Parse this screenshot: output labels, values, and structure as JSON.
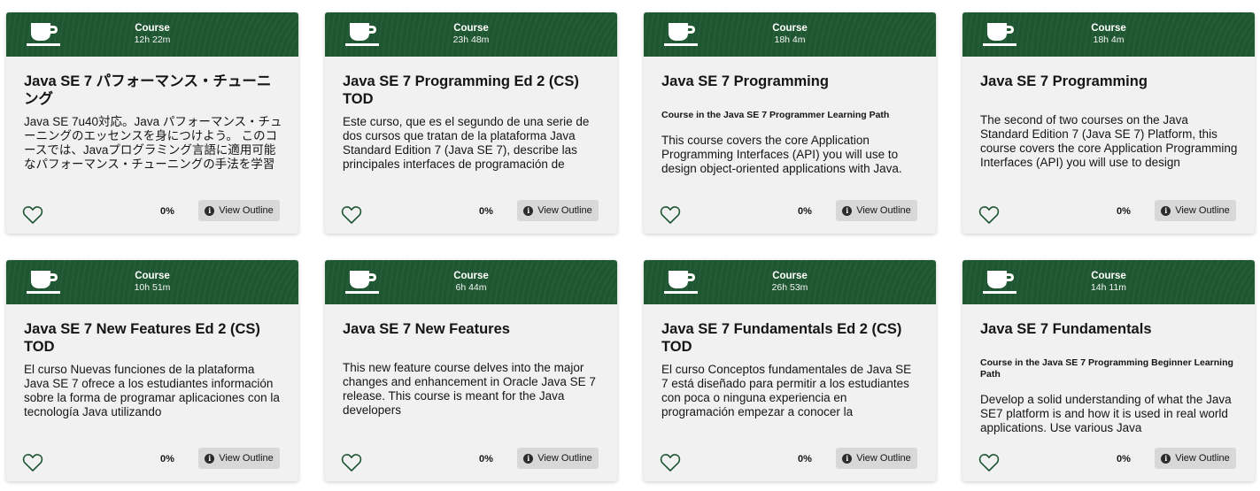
{
  "accent_color": "#1e5631",
  "icons": {
    "card_icon": "coffee-cup-icon",
    "favorite_icon": "heart-outline-icon",
    "outline_icon": "info-icon"
  },
  "cards": [
    {
      "type": "Course",
      "duration": "12h 22m",
      "title": "Java SE 7 パフォーマンス・チューニング",
      "learning_path": "",
      "description": "Java SE 7u40対応。Java パフォーマンス・チューニングのエッセンスを身につけよう。 このコースでは、Javaプログラミング言語に適用可能なパフォーマンス・チューニングの手法を学習します。",
      "progress": "0%",
      "button_label": "View Outline"
    },
    {
      "type": "Course",
      "duration": "23h 48m",
      "title": "Java SE 7 Programming Ed 2 (CS) TOD",
      "learning_path": "",
      "description": "Este curso, que es el segundo de una serie de dos cursos que tratan de la plataforma Java Standard Edition 7 (Java SE 7), describe las principales interfaces de programación de aplicaciones",
      "progress": "0%",
      "button_label": "View Outline"
    },
    {
      "type": "Course",
      "duration": "18h 4m",
      "title": "Java SE 7 Programming",
      "learning_path": "Course in the Java SE 7 Programmer Learning Path",
      "description": "This course covers the core Application Programming Interfaces (API) you will use to design object-oriented applications with Java.",
      "progress": "0%",
      "button_label": "View Outline"
    },
    {
      "type": "Course",
      "duration": "18h 4m",
      "title": "Java SE 7 Programming",
      "learning_path": "",
      "description": "The second of two courses on the Java Standard Edition 7 (Java SE 7) Platform, this course covers the core Application Programming Interfaces (API) you will use to design",
      "progress": "0%",
      "button_label": "View Outline"
    },
    {
      "type": "Course",
      "duration": "10h 51m",
      "title": "Java SE 7 New Features Ed 2 (CS) TOD",
      "learning_path": "",
      "description": "El curso Nuevas funciones de la plataforma Java SE 7 ofrece a los estudiantes información sobre la forma de programar aplicaciones con la tecnología Java utilizando",
      "progress": "0%",
      "button_label": "View Outline"
    },
    {
      "type": "Course",
      "duration": "6h 44m",
      "title": "Java SE 7 New Features",
      "learning_path": "",
      "description": "This new feature course delves into the major changes and enhancement in Oracle Java SE 7 release. This course is meant for the Java developers",
      "progress": "0%",
      "button_label": "View Outline"
    },
    {
      "type": "Course",
      "duration": "26h 53m",
      "title": "Java SE 7 Fundamentals Ed 2 (CS) TOD",
      "learning_path": "",
      "description": "El curso Conceptos fundamentales de Java SE 7 está diseñado para permitir a los estudiantes con poca o ninguna experiencia en programación empezar a conocer la",
      "progress": "0%",
      "button_label": "View Outline"
    },
    {
      "type": "Course",
      "duration": "14h 11m",
      "title": "Java SE 7 Fundamentals",
      "learning_path": "Course in the Java SE 7 Programming Beginner Learning Path",
      "description": "Develop a solid understanding of what the Java SE7 platform is and how it is used in real world applications. Use various Java",
      "progress": "0%",
      "button_label": "View Outline"
    }
  ]
}
